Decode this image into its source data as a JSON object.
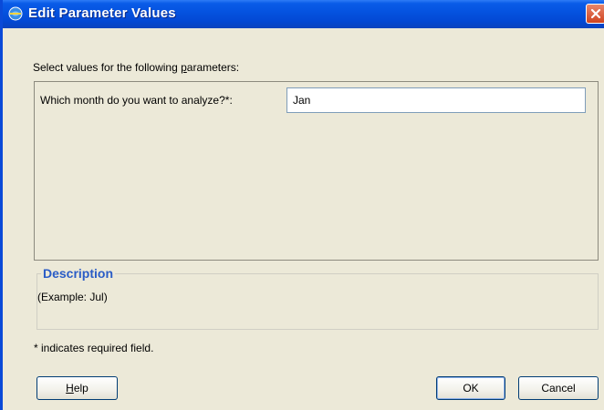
{
  "window": {
    "title": "Edit Parameter Values"
  },
  "prompt": {
    "before_mnemonic": "Select values for the following ",
    "mnemonic": "p",
    "after_mnemonic": "arameters:"
  },
  "parameters": [
    {
      "label": "Which month do you want to analyze?*:",
      "value": "Jan"
    }
  ],
  "description": {
    "legend": "Description",
    "text": "(Example: Jul)"
  },
  "required_note": "* indicates required field.",
  "buttons": {
    "help_mnemonic": "H",
    "help_rest": "elp",
    "ok": "OK",
    "cancel": "Cancel"
  },
  "colors": {
    "titlebar": "#0553e0",
    "dialog_bg": "#ece9d8",
    "description_legend": "#2a5cc6",
    "close_button": "#d0441f"
  },
  "icons": {
    "title": "app-globe-icon",
    "close": "close-x-icon"
  }
}
